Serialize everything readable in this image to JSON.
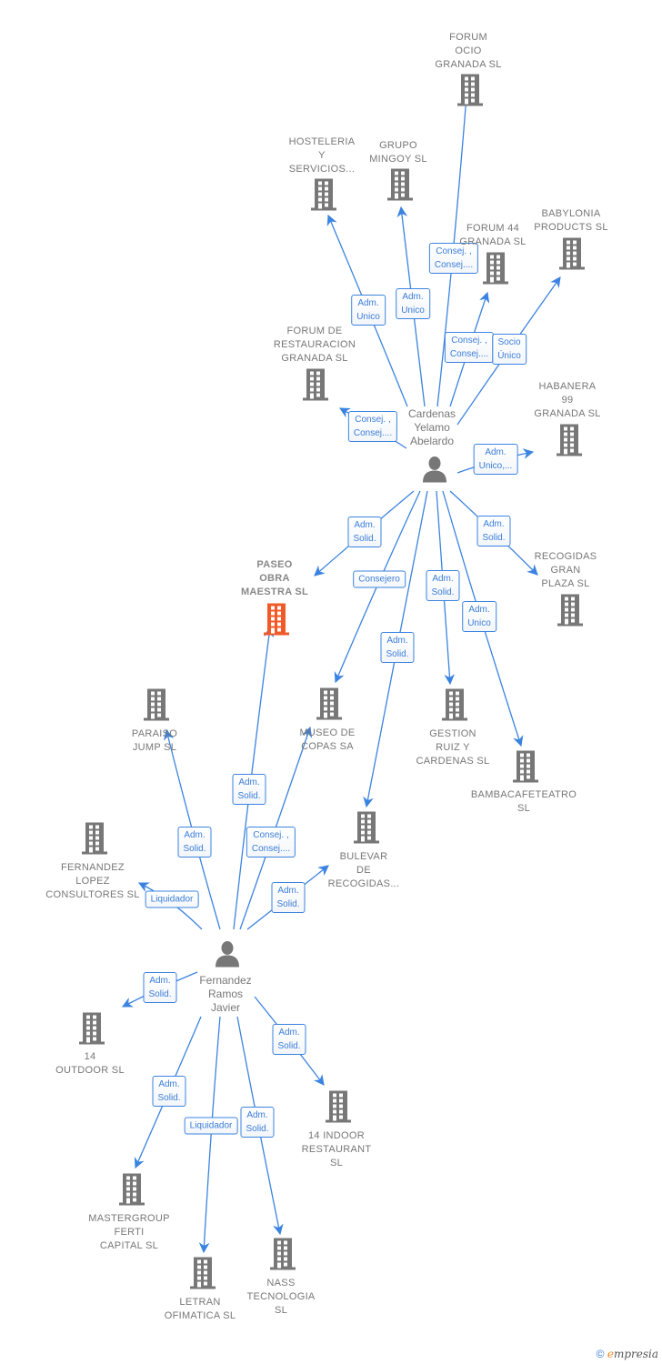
{
  "colors": {
    "edge": "#3b83e0",
    "building": "#777777",
    "center_building": "#f05a28",
    "person": "#777777"
  },
  "persons": [
    {
      "id": "cardenas",
      "label": "Cardenas\nYelamo\nAbelardo",
      "icon": "person-icon"
    },
    {
      "id": "fernandez",
      "label": "Fernandez\nRamos\nJavier",
      "icon": "person-icon"
    }
  ],
  "companies": [
    {
      "id": "forum_ocio",
      "label": "FORUM\nOCIO\nGRANADA SL",
      "icon": "building-icon"
    },
    {
      "id": "hosteleria",
      "label": "HOSTELERIA\nY\nSERVICIOS...",
      "icon": "building-icon"
    },
    {
      "id": "grupo_mingoy",
      "label": "GRUPO\nMINGOY SL",
      "icon": "building-icon"
    },
    {
      "id": "forum44",
      "label": "FORUM 44\nGRANADA SL",
      "icon": "building-icon"
    },
    {
      "id": "babylonia",
      "label": "BABYLONIA\nPRODUCTS  SL",
      "icon": "building-icon"
    },
    {
      "id": "forum_restauracion",
      "label": "FORUM DE\nRESTAURACION\nGRANADA SL",
      "icon": "building-icon"
    },
    {
      "id": "habanera",
      "label": "HABANERA\n99\nGRANADA  SL",
      "icon": "building-icon"
    },
    {
      "id": "paseo",
      "label": "PASEO\nOBRA\nMAESTRA  SL",
      "icon": "building-icon",
      "center": true
    },
    {
      "id": "recogidas",
      "label": "RECOGIDAS\nGRAN\nPLAZA  SL",
      "icon": "building-icon"
    },
    {
      "id": "paraiso",
      "label": "PARAISO\nJUMP  SL",
      "icon": "building-icon"
    },
    {
      "id": "museo",
      "label": "MUSEO DE\nCOPAS SA",
      "icon": "building-icon"
    },
    {
      "id": "gestion",
      "label": "GESTION\nRUIZ Y\nCARDENAS  SL",
      "icon": "building-icon"
    },
    {
      "id": "bambacafe",
      "label": "BAMBACAFETEATRO\nSL",
      "icon": "building-icon"
    },
    {
      "id": "fernandez_lopez",
      "label": "FERNANDEZ\nLOPEZ\nCONSULTORES SL",
      "icon": "building-icon"
    },
    {
      "id": "bulevar",
      "label": "BULEVAR\nDE\nRECOGIDAS...",
      "icon": "building-icon"
    },
    {
      "id": "outdoor14",
      "label": "14\nOUTDOOR  SL",
      "icon": "building-icon"
    },
    {
      "id": "indoor14",
      "label": "14 INDOOR\nRESTAURANT\nSL",
      "icon": "building-icon"
    },
    {
      "id": "mastergroup",
      "label": "MASTERGROUP\nFERTI\nCAPITAL  SL",
      "icon": "building-icon"
    },
    {
      "id": "letran",
      "label": "LETRAN\nOFIMATICA SL",
      "icon": "building-icon"
    },
    {
      "id": "nass",
      "label": "NASS\nTECNOLOGIA\nSL",
      "icon": "building-icon"
    }
  ],
  "edges": [
    {
      "from": "cardenas",
      "to": "hosteleria",
      "label": "Adm.\nUnico"
    },
    {
      "from": "cardenas",
      "to": "grupo_mingoy",
      "label": "Adm.\nUnico"
    },
    {
      "from": "cardenas",
      "to": "forum_ocio",
      "label": "Consej. ,\nConsej...."
    },
    {
      "from": "cardenas",
      "to": "forum44",
      "label": "Consej. ,\nConsej...."
    },
    {
      "from": "cardenas",
      "to": "babylonia",
      "label": "Socio\nÚnico"
    },
    {
      "from": "cardenas",
      "to": "forum_restauracion",
      "label": "Consej. ,\nConsej...."
    },
    {
      "from": "cardenas",
      "to": "habanera",
      "label": "Adm.\nUnico,..."
    },
    {
      "from": "cardenas",
      "to": "paseo",
      "label": "Adm.\nSolid."
    },
    {
      "from": "cardenas",
      "to": "museo",
      "label": "Consejero"
    },
    {
      "from": "cardenas",
      "to": "bulevar",
      "label": "Adm.\nSolid."
    },
    {
      "from": "cardenas",
      "to": "gestion",
      "label": "Adm.\nSolid."
    },
    {
      "from": "cardenas",
      "to": "recogidas",
      "label": "Adm.\nSolid."
    },
    {
      "from": "cardenas",
      "to": "bambacafe",
      "label": "Adm.\nUnico"
    },
    {
      "from": "fernandez",
      "to": "paseo",
      "label": "Adm.\nSolid."
    },
    {
      "from": "fernandez",
      "to": "paraiso",
      "label": "Adm.\nSolid."
    },
    {
      "from": "fernandez",
      "to": "museo",
      "label": "Consej. ,\nConsej...."
    },
    {
      "from": "fernandez",
      "to": "fernandez_lopez",
      "label": "Liquidador"
    },
    {
      "from": "fernandez",
      "to": "bulevar",
      "label": "Adm.\nSolid."
    },
    {
      "from": "fernandez",
      "to": "outdoor14",
      "label": "Adm.\nSolid."
    },
    {
      "from": "fernandez",
      "to": "indoor14",
      "label": "Adm.\nSolid."
    },
    {
      "from": "fernandez",
      "to": "mastergroup",
      "label": "Adm.\nSolid."
    },
    {
      "from": "fernandez",
      "to": "letran",
      "label": "Liquidador"
    },
    {
      "from": "fernandez",
      "to": "nass",
      "label": "Adm.\nSolid."
    }
  ],
  "footer": {
    "copyright": "©",
    "brand_first": "e",
    "brand_rest": "mpresia"
  }
}
